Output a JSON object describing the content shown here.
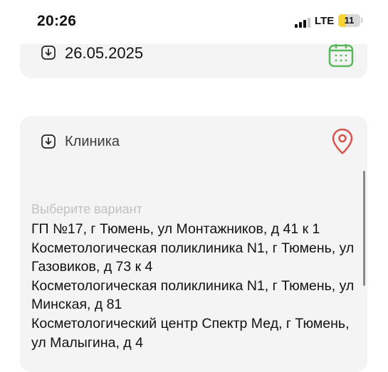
{
  "status_bar": {
    "time": "20:26",
    "network": "LTE",
    "battery": "11"
  },
  "date_field": {
    "value": "26.05.2025",
    "icon": "download-circle-icon",
    "calendar_icon": "calendar-icon",
    "calendar_color": "#59b85b"
  },
  "clinic_field": {
    "label": "Клиника",
    "icon": "download-circle-icon",
    "location_icon": "location-pin-icon",
    "location_color": "#d9534f",
    "placeholder": "Выберите вариант",
    "options": [
      "ГП №17, г Тюмень, ул Монтажников, д 41 к 1",
      "Косметологическая поликлиника N1, г Тюмень, ул Газовиков, д 73 к 4",
      "Косметологическая поликлиника N1, г Тюмень, ул Минская, д 81",
      "Косметологический центр Спектр Мед, г Тюмень, ул Малыгина, д 4"
    ]
  }
}
